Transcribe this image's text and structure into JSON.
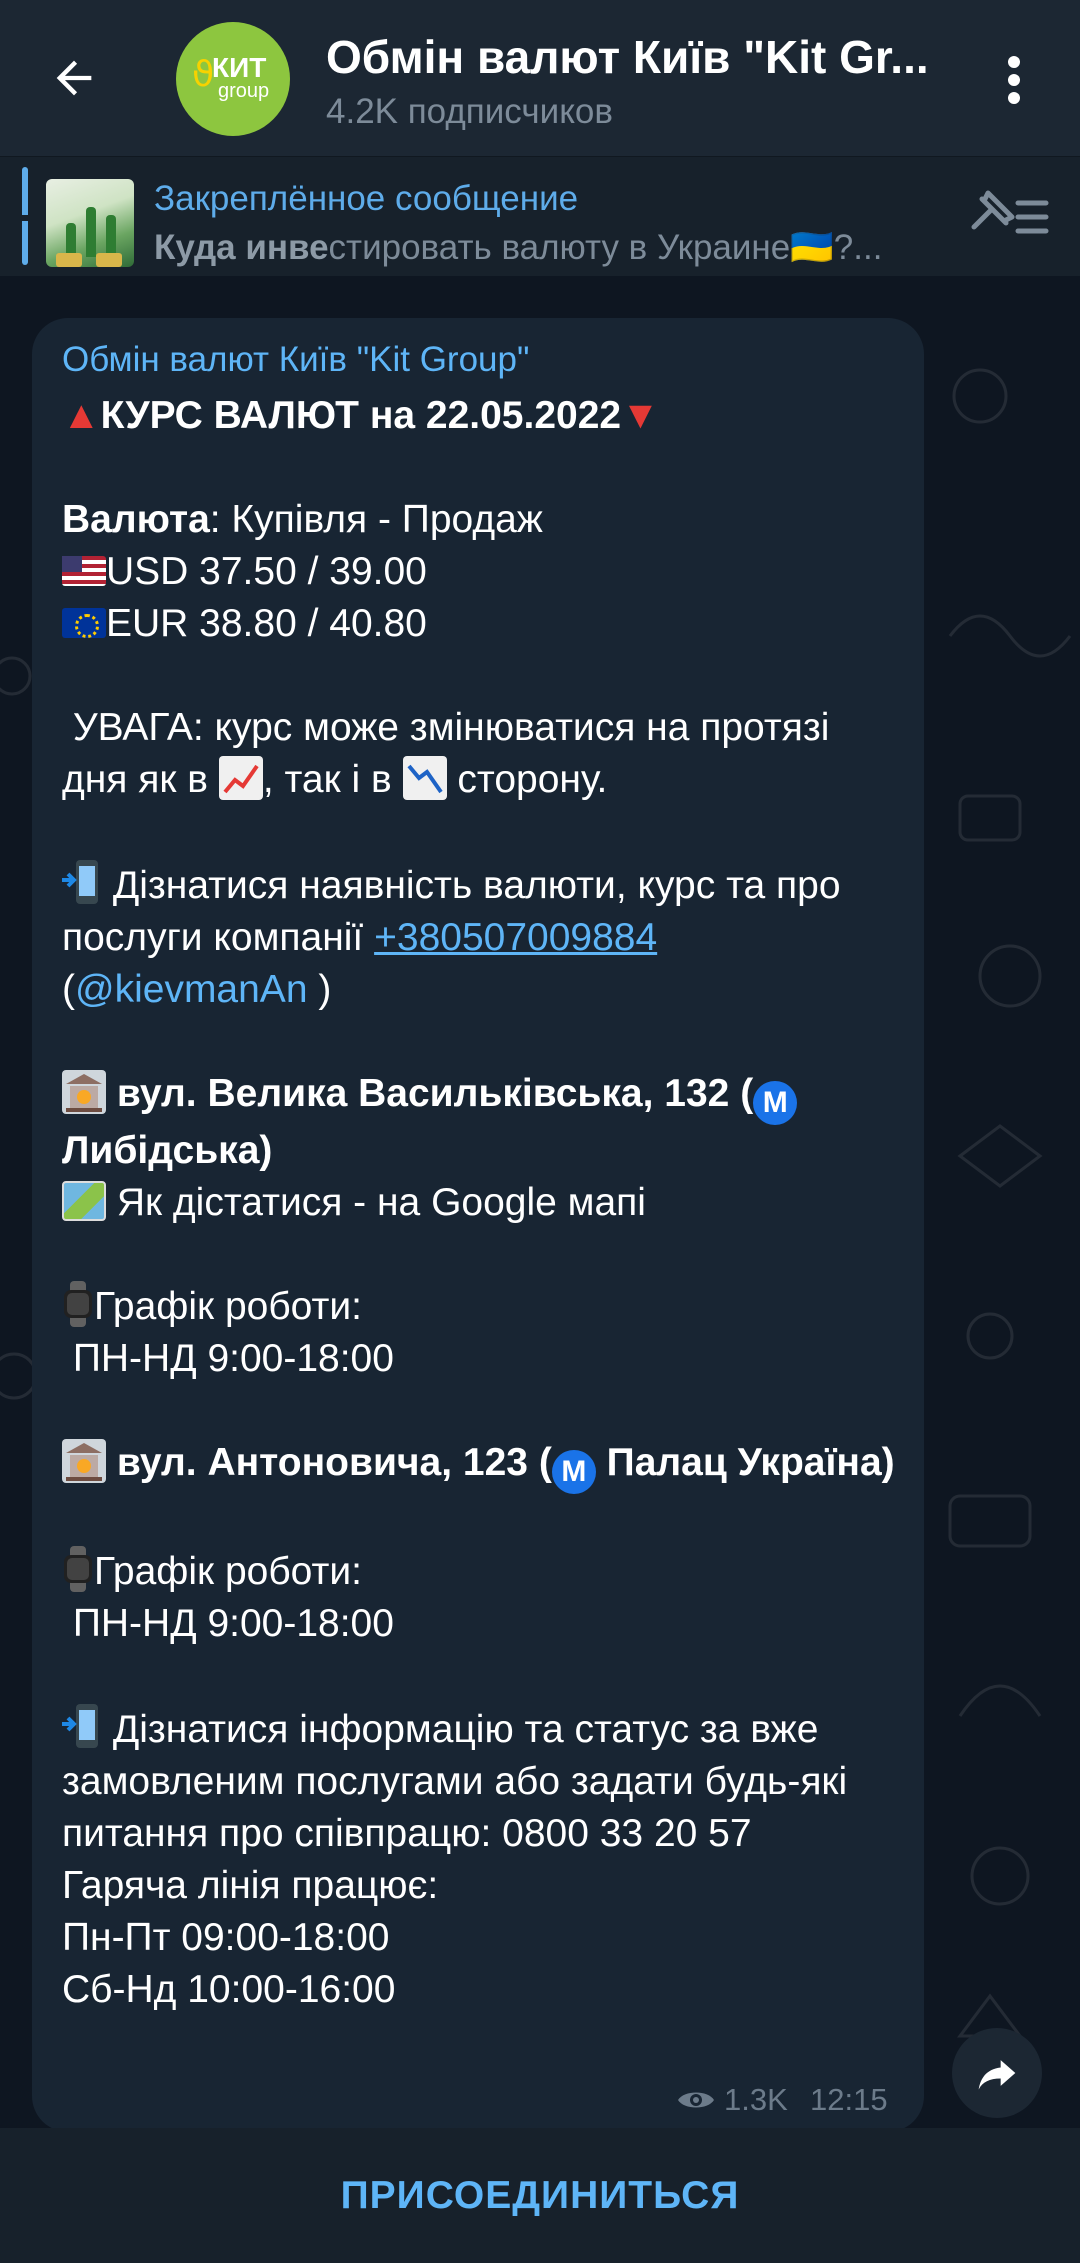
{
  "header": {
    "title": "Обмін валют Київ \"Kit Gr...",
    "subscribers": "4.2K подписчиков",
    "avatar_text_main": "КИТ",
    "avatar_text_sub": "group"
  },
  "pinned": {
    "label": "Закреплённое сообщение",
    "text_bold": "Куда инве",
    "text_rest": "стировать валюту в Украине🇺🇦?..."
  },
  "message": {
    "author": "Обмін валют Київ \"Kit Group\"",
    "headline": "КУРС ВАЛЮТ на 22.05.2022",
    "currency_header_bold": "Валюта",
    "currency_header_rest": ": Купівля - Продаж",
    "usd": "USD 37.50 / 39.00",
    "eur": "EUR 38.80 / 40.80",
    "warning_a": " УВАГА: курс може змінюватися на протязі дня як в ",
    "warning_b": ", так і в ",
    "warning_c": " сторону.",
    "contact_a": " Дізнатися наявність валюти, курс та про послуги компанії ",
    "phone_link": "+380507009884",
    "contact_b_open": "(",
    "mention": "@kievmanAn",
    "contact_b_close": " )",
    "addr1_a": " вул. Велика Васильківська, 132 (",
    "addr1_b": " Либідська)",
    "maps_text": " Як дістатися - на Google мапі",
    "schedule_label_1": "Графік роботи:",
    "schedule_1": " ПН-НД 9:00-18:00",
    "addr2_a": " вул. Антоновича, 123 (",
    "addr2_b": " Палац Україна)",
    "schedule_label_2": "Графік роботи:",
    "schedule_2": " ПН-НД 9:00-18:00",
    "info": " Дізнатися інформацію та статус за вже замовленим послугами або задати будь-які питання про співпрацю: 0800 33 20 57",
    "hotline": "Гаряча лінія працює:",
    "hotline_weekdays": "Пн-Пт 09:00-18:00",
    "hotline_weekend": "Сб-Нд 10:00-16:00",
    "metro_letter": "M",
    "views": "1.3K",
    "time": "12:15"
  },
  "join": {
    "label": "ПРИСОЕДИНИТЬСЯ"
  },
  "icons": {
    "back": "arrow-left-icon",
    "menu": "more-vertical-icon",
    "pin_list": "pin-list-icon",
    "eye": "eye-icon",
    "share": "share-forward-icon"
  },
  "colors": {
    "background": "#0e1621",
    "header": "#1c2733",
    "bubble": "#182533",
    "accent": "#5eb5f7",
    "avatar": "#8dc63f"
  }
}
